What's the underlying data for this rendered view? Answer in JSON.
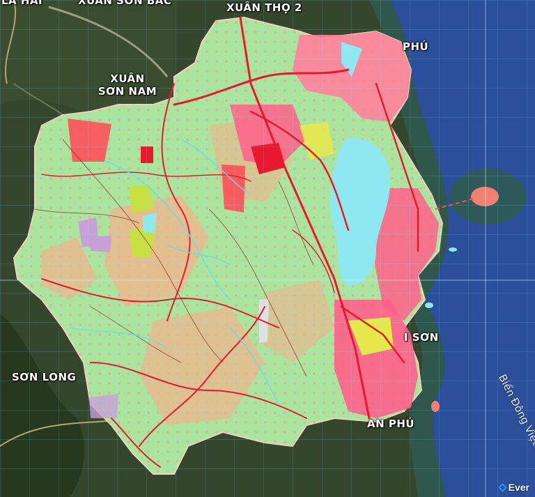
{
  "map": {
    "places": {
      "lahai": "LA HAI",
      "xuansonbac": "XUÂN SƠN BẮC",
      "xuantho2": "XUÂN THỌ 2",
      "xuansonnam_line1": "XUÂN",
      "xuansonnam_line2": "SƠN NAM",
      "phu": "PHÚ",
      "son": "I SƠN",
      "sonlong": "SƠN LONG",
      "anphu": "AN PHÚ"
    },
    "sea_label": "Biển Đông Việt N",
    "brand": "Ever",
    "colors": {
      "sea": "#2b4f9a",
      "forest": "#2f4a2a",
      "agri_land": "#a8e6a0",
      "urban": "#ff6b8a",
      "roads": "#e8182e",
      "water": "#8fe8f0",
      "industrial": "#e6e84a"
    }
  }
}
